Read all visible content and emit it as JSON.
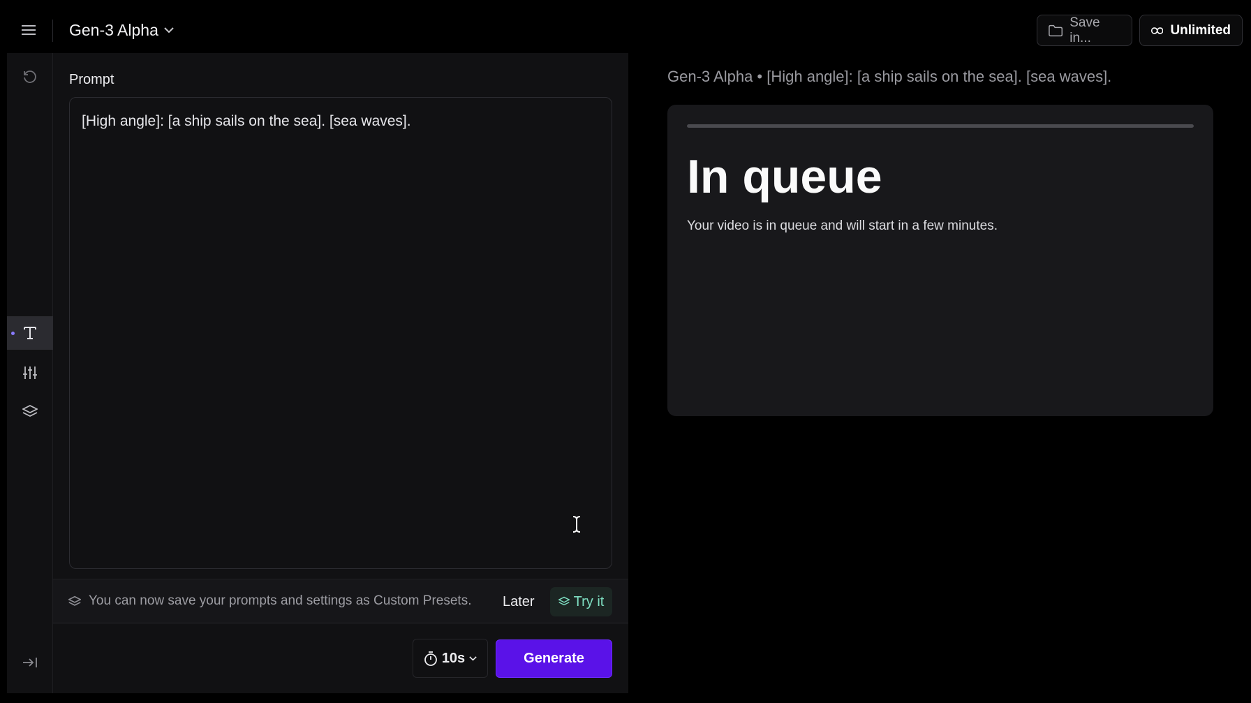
{
  "header": {
    "model_name": "Gen-3 Alpha",
    "save_label": "Save in...",
    "plan_label": "Unlimited"
  },
  "sidebar": {
    "items": [
      {
        "icon": "history-icon"
      },
      {
        "icon": "text-icon",
        "active": true
      },
      {
        "icon": "sliders-icon"
      },
      {
        "icon": "layers-icon"
      },
      {
        "icon": "collapse-icon"
      }
    ]
  },
  "prompt": {
    "label": "Prompt",
    "value": "[High angle]: [a ship sails on the sea]. [sea waves]."
  },
  "preset_notice": {
    "text": "You can now save your prompts and settings as Custom Presets.",
    "later_label": "Later",
    "try_label": "Try it"
  },
  "controls": {
    "duration": "10s",
    "generate_label": "Generate"
  },
  "output": {
    "title": "Gen-3 Alpha • [High angle]: [a ship sails on the sea]. [sea waves].",
    "status_heading": "In queue",
    "status_message": "Your video is in queue and will start in a few minutes.",
    "progress": 1.0
  },
  "colors": {
    "accent": "#5a12e8",
    "try_it": "#7fe0c3"
  }
}
